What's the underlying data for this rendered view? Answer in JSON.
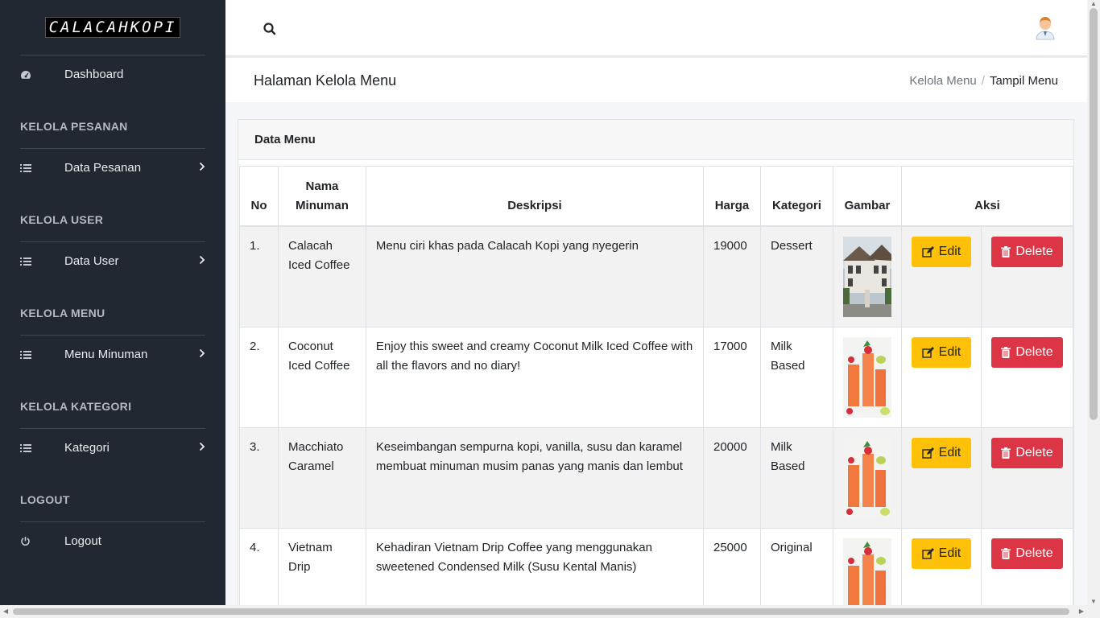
{
  "brand": {
    "name": "CALACAHKOPI"
  },
  "sidebar": {
    "dashboard": {
      "label": "Dashboard",
      "icon": "dashboard-icon"
    },
    "sections": [
      {
        "title": "KELOLA PESANAN",
        "item": {
          "label": "Data Pesanan",
          "icon": "list-icon"
        }
      },
      {
        "title": "KELOLA USER",
        "item": {
          "label": "Data User",
          "icon": "list-icon"
        }
      },
      {
        "title": "KELOLA MENU",
        "item": {
          "label": "Menu Minuman",
          "icon": "list-icon"
        }
      },
      {
        "title": "KELOLA KATEGORI",
        "item": {
          "label": "Kategori",
          "icon": "list-icon"
        }
      }
    ],
    "logout_section": {
      "title": "LOGOUT",
      "item": {
        "label": "Logout",
        "icon": "power-icon"
      }
    }
  },
  "topbar": {
    "search_icon": "search-icon",
    "avatar_icon": "user-avatar-icon"
  },
  "header": {
    "title": "Halaman Kelola Menu",
    "breadcrumb": [
      "Kelola Menu",
      "Tampil Menu"
    ],
    "breadcrumb_sep": "/"
  },
  "card": {
    "title": "Data Menu",
    "columns": {
      "no": "No",
      "name_line1": "Nama",
      "name_line2": "Minuman",
      "desc": "Deskripsi",
      "price": "Harga",
      "category": "Kategori",
      "image": "Gambar",
      "action": "Aksi"
    },
    "rows": [
      {
        "no": "1.",
        "name": "Calacah Iced Coffee",
        "desc": "Menu ciri khas pada Calacah Kopi yang nyegerin",
        "price": "19000",
        "category": "Dessert",
        "image": "building-photo"
      },
      {
        "no": "2.",
        "name": "Coconut Iced Coffee",
        "desc": "Enjoy this sweet and creamy Coconut Milk Iced Coffee with all the flavors and no diary!",
        "price": "17000",
        "category": "Milk Based",
        "image": "drinks-photo"
      },
      {
        "no": "3.",
        "name": "Macchiato Caramel",
        "desc": "Keseimbangan sempurna kopi, vanilla, susu dan karamel membuat minuman musim panas yang manis dan lembut",
        "price": "20000",
        "category": "Milk Based",
        "image": "drinks-photo"
      },
      {
        "no": "4.",
        "name": "Vietnam Drip",
        "desc": "Kehadiran Vietnam Drip Coffee yang menggunakan sweetened Condensed Milk (Susu Kental Manis)",
        "price": "25000",
        "category": "Original",
        "image": "drinks-photo"
      }
    ],
    "edit_label": "Edit",
    "delete_label": "Delete"
  },
  "colors": {
    "sidebar_bg": "#222831",
    "edit": "#ffc107",
    "delete": "#dc3545"
  }
}
